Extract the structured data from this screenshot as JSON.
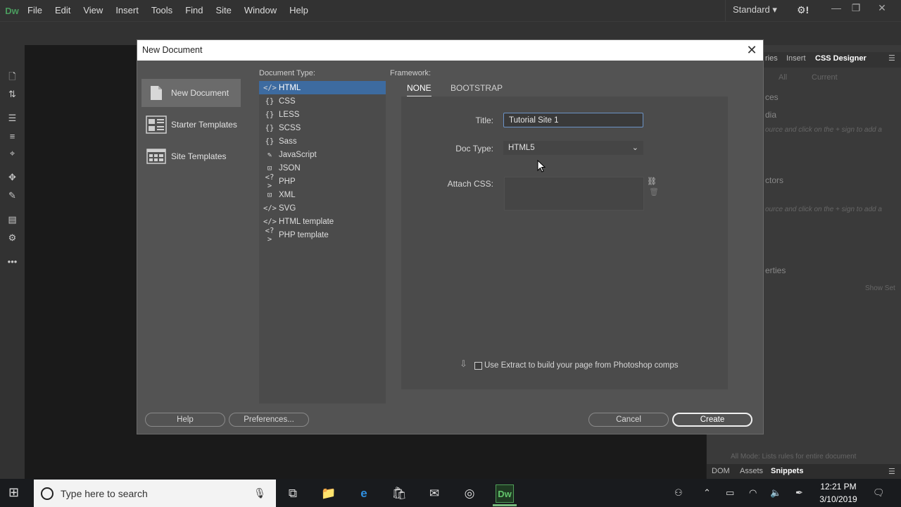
{
  "app": {
    "logo": "Dw",
    "workspace": "Standard"
  },
  "menu": [
    "File",
    "Edit",
    "View",
    "Insert",
    "Tools",
    "Find",
    "Site",
    "Window",
    "Help"
  ],
  "right_panel": {
    "tabs": [
      "ries",
      "Insert",
      "CSS Designer"
    ],
    "sub_tabs": [
      "All",
      "Current"
    ],
    "sections": [
      "ces",
      "dia",
      "ctors",
      "erties"
    ],
    "hints": [
      "ource and click on the + sign to add a",
      "ource and click on the + sign to add a"
    ],
    "show_set": "Show Set",
    "footer_hint": "All Mode: Lists rules for entire document",
    "bottom_tabs": [
      "DOM",
      "Assets",
      "Snippets"
    ]
  },
  "dialog": {
    "title": "New Document",
    "sidebar": [
      {
        "label": "New Document",
        "icon": "document-icon"
      },
      {
        "label": "Starter Templates",
        "icon": "starter-templates-icon"
      },
      {
        "label": "Site Templates",
        "icon": "site-templates-icon"
      }
    ],
    "doc_type_label": "Document Type:",
    "doc_types": [
      {
        "icon": "</>",
        "label": "HTML"
      },
      {
        "icon": "{}",
        "label": "CSS"
      },
      {
        "icon": "{}",
        "label": "LESS"
      },
      {
        "icon": "{}",
        "label": "SCSS"
      },
      {
        "icon": "{}",
        "label": "Sass"
      },
      {
        "icon": "✎",
        "label": "JavaScript"
      },
      {
        "icon": "⊡",
        "label": "JSON"
      },
      {
        "icon": "<?>",
        "label": "PHP"
      },
      {
        "icon": "⊡",
        "label": "XML"
      },
      {
        "icon": "</>",
        "label": "SVG"
      },
      {
        "icon": "</>",
        "label": "HTML template"
      },
      {
        "icon": "<?>",
        "label": "PHP template"
      }
    ],
    "framework_label": "Framework:",
    "framework_tabs": [
      "NONE",
      "BOOTSTRAP"
    ],
    "title_label": "Title:",
    "title_value": "Tutorial Site 1",
    "doctype_label": "Doc Type:",
    "doctype_value": "HTML5",
    "attach_css_label": "Attach CSS:",
    "extract_label": "Use Extract to build your page from Photoshop comps",
    "buttons": {
      "help": "Help",
      "preferences": "Preferences...",
      "cancel": "Cancel",
      "create": "Create"
    }
  },
  "taskbar": {
    "search_placeholder": "Type here to search",
    "dw_label": "Dw",
    "time": "12:21 PM",
    "date": "3/10/2019"
  }
}
